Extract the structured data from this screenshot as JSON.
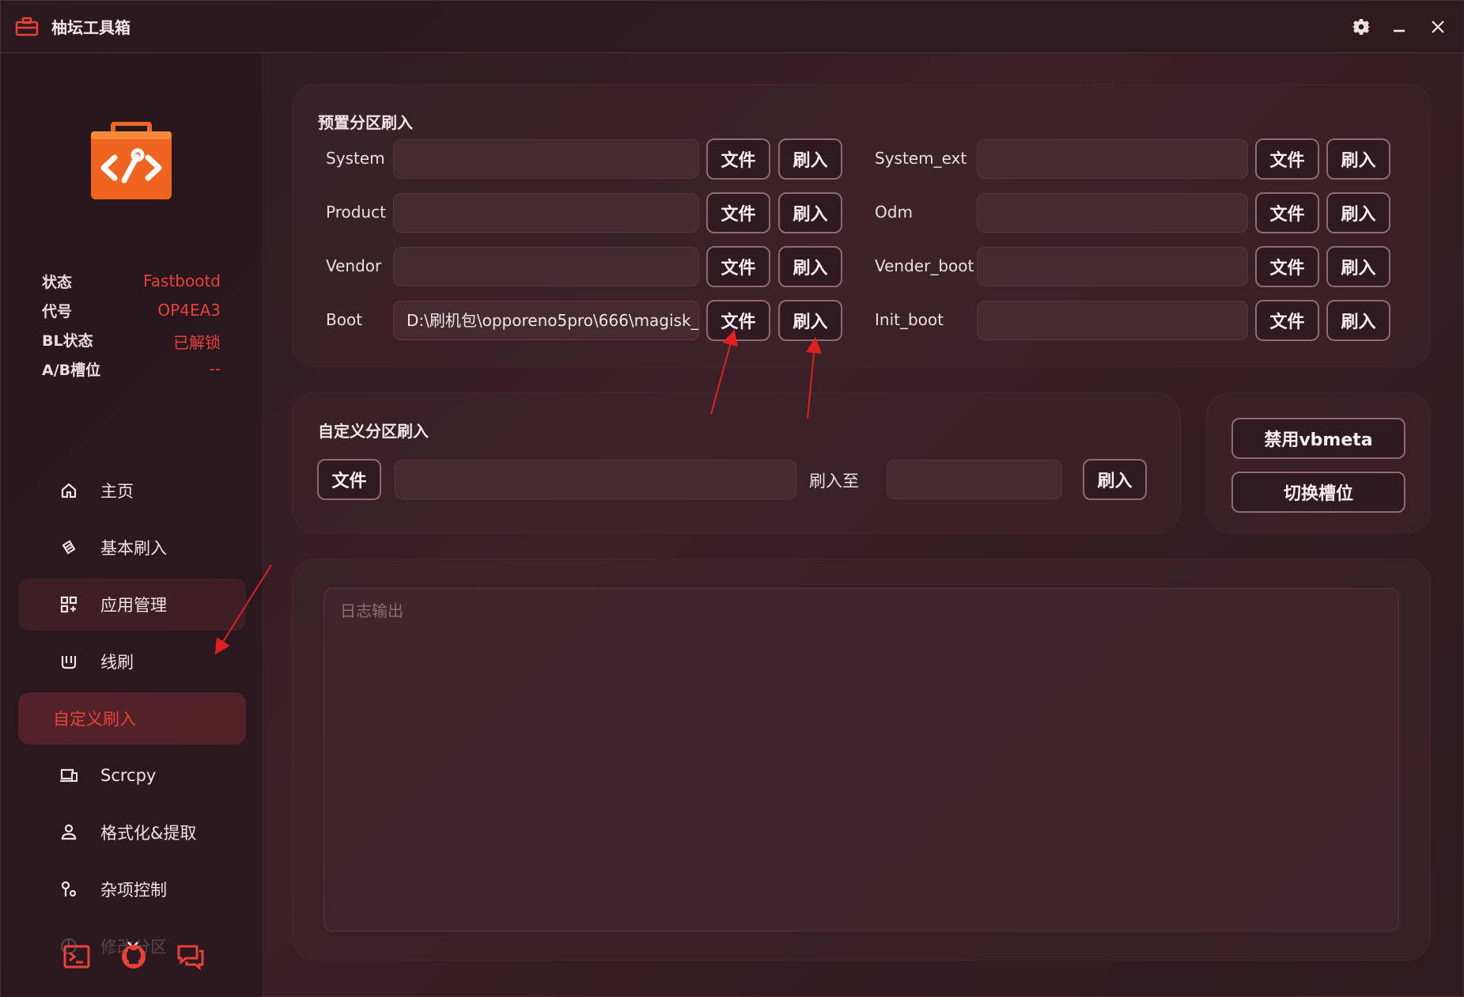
{
  "window": {
    "title": "柚坛工具箱",
    "accent": "#e8413a"
  },
  "titlebar": {
    "icons": [
      "toolbox-icon",
      "gear-icon",
      "minimize-icon",
      "close-icon"
    ]
  },
  "sidebar": {
    "status": [
      {
        "label": "状态",
        "value": "Fastbootd"
      },
      {
        "label": "代号",
        "value": "OP4EA3"
      },
      {
        "label": "BL状态",
        "value": "已解锁"
      },
      {
        "label": "A/B槽位",
        "value": "--"
      }
    ],
    "nav": [
      {
        "label": "主页",
        "icon": "home-icon"
      },
      {
        "label": "基本刷入",
        "icon": "flash-icon"
      },
      {
        "label": "应用管理",
        "icon": "apps-icon"
      },
      {
        "label": "线刷",
        "icon": "cable-icon"
      },
      {
        "label": "自定义刷入",
        "icon": ""
      },
      {
        "label": "Scrcpy",
        "icon": "screen-mirror-icon"
      },
      {
        "label": "格式化&提取",
        "icon": "format-icon"
      },
      {
        "label": "杂项控制",
        "icon": "tools-icon"
      },
      {
        "label": "修改分区",
        "icon": "partition-icon"
      }
    ],
    "bottom_icons": [
      "terminal-icon",
      "github-icon",
      "chat-icon"
    ]
  },
  "preset": {
    "title": "预置分区刷入",
    "file_label": "文件",
    "flash_label": "刷入",
    "left": [
      {
        "label": "System",
        "value": ""
      },
      {
        "label": "Product",
        "value": ""
      },
      {
        "label": "Vendor",
        "value": ""
      },
      {
        "label": "Boot",
        "value": "D:\\刷机包\\opporeno5pro\\666\\magisk_"
      }
    ],
    "right": [
      {
        "label": "System_ext",
        "value": ""
      },
      {
        "label": "Odm",
        "value": ""
      },
      {
        "label": "Vender_boot",
        "value": ""
      },
      {
        "label": "Init_boot",
        "value": ""
      }
    ]
  },
  "custom": {
    "title": "自定义分区刷入",
    "file_label": "文件",
    "path_value": "",
    "to_label": "刷入至",
    "partition_value": "",
    "flash_label": "刷入"
  },
  "side_actions": {
    "disable_vbmeta": "禁用vbmeta",
    "switch_slot": "切换槽位"
  },
  "log": {
    "placeholder": "日志输出"
  }
}
